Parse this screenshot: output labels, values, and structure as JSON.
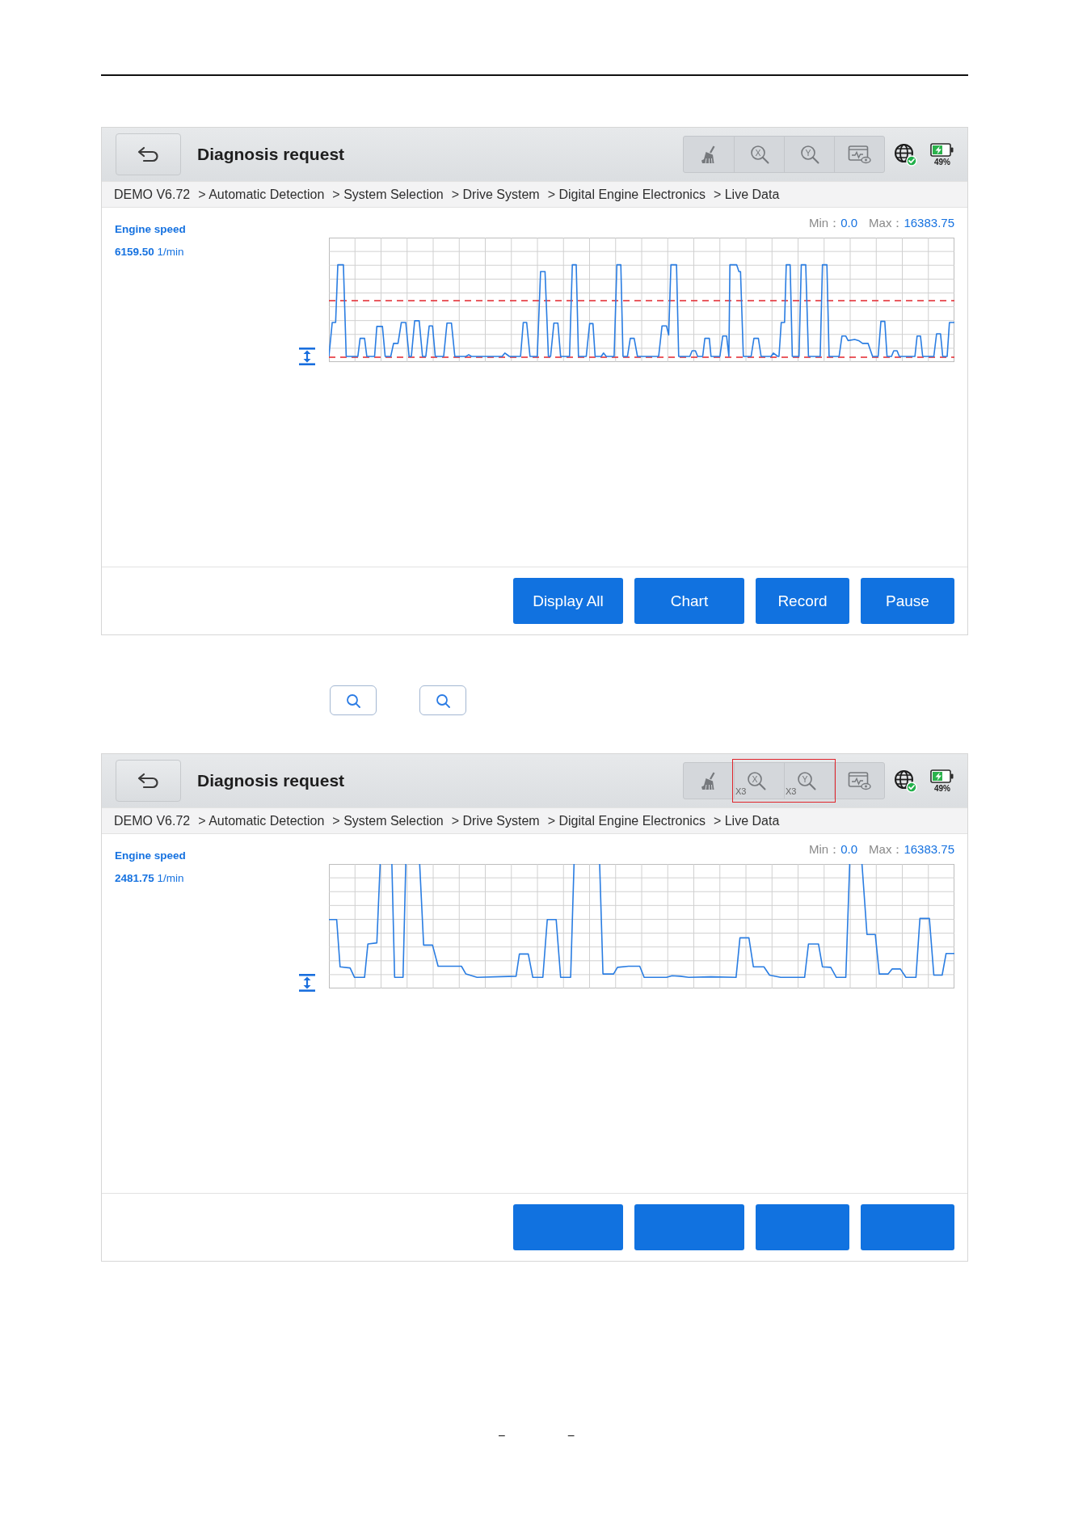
{
  "screen_top": {
    "header": {
      "title": "Diagnosis request",
      "toolbar": [
        {
          "kind": "broom",
          "highlighted": false
        },
        {
          "kind": "zoom",
          "letter": "X",
          "highlighted": false
        },
        {
          "kind": "zoom",
          "letter": "Y",
          "highlighted": false
        },
        {
          "kind": "monitor",
          "highlighted": false
        }
      ],
      "battery": "49%"
    },
    "breadcrumb": [
      "DEMO V6.72",
      "> Automatic Detection",
      "> System Selection",
      "> Drive System",
      "> Digital Engine Electronics",
      "> Live Data"
    ],
    "signal": {
      "name": "Engine speed",
      "value": "6159.50",
      "unit": "1/min"
    },
    "graph": {
      "min_label": "Min：",
      "min": "0.0",
      "max_label": "Max：",
      "max": "16383.75",
      "limit_lines": true
    },
    "buttons": [
      {
        "kind": "text",
        "label": "Display All"
      },
      {
        "kind": "text",
        "label": "Chart"
      },
      {
        "kind": "text",
        "label": "Record"
      },
      {
        "kind": "text",
        "label": "Pause"
      }
    ]
  },
  "icon_buttons": [
    {
      "kind": "search"
    },
    {
      "kind": "search"
    }
  ],
  "screen_bottom": {
    "header": {
      "title": "Diagnosis request",
      "toolbar": [
        {
          "kind": "broom",
          "highlighted": false
        },
        {
          "kind": "zoom",
          "letter": "X",
          "badge": "X3",
          "highlighted": true
        },
        {
          "kind": "zoom",
          "letter": "Y",
          "badge": "X3",
          "highlighted": true
        },
        {
          "kind": "monitor",
          "highlighted": false
        }
      ],
      "battery": "49%"
    },
    "breadcrumb": [
      "DEMO V6.72",
      "> Automatic Detection",
      "> System Selection",
      "> Drive System",
      "> Digital Engine Electronics",
      "> Live Data"
    ],
    "signal": {
      "name": "Engine speed",
      "value": "2481.75",
      "unit": "1/min"
    },
    "graph": {
      "min_label": "Min：",
      "min": "0.0",
      "max_label": "Max：",
      "max": "16383.75",
      "limit_lines": false
    },
    "buttons": [
      {
        "kind": "blank"
      },
      {
        "kind": "blank"
      },
      {
        "kind": "blank"
      },
      {
        "kind": "blank"
      }
    ]
  },
  "footer_marks": [
    "–",
    "–"
  ]
}
